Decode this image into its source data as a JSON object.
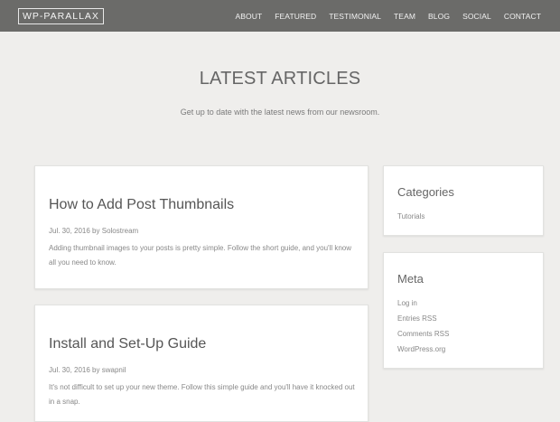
{
  "header": {
    "logo": "WP-PARALLAX",
    "nav": [
      "ABOUT",
      "FEATURED",
      "TESTIMONIAL",
      "TEAM",
      "BLOG",
      "SOCIAL",
      "CONTACT"
    ]
  },
  "section": {
    "title": "LATEST ARTICLES",
    "subtitle": "Get up to date with the latest news from our newsroom."
  },
  "posts": [
    {
      "title": "How to Add Post Thumbnails",
      "date": "Jul. 30, 2016",
      "by": "by",
      "author": "Solostream",
      "excerpt": "Adding thumbnail images to your posts is pretty simple. Follow the short guide, and you'll know all you need to know."
    },
    {
      "title": "Install and Set-Up Guide",
      "date": "Jul. 30, 2016",
      "by": "by",
      "author": "swapnil",
      "excerpt": "It's not difficult to set up your new theme. Follow this simple guide and you'll have it knocked out in a snap."
    }
  ],
  "sidebar": {
    "categories": {
      "title": "Categories",
      "items": [
        "Tutorials"
      ]
    },
    "meta": {
      "title": "Meta",
      "items": [
        "Log in",
        "Entries RSS",
        "Comments RSS",
        "WordPress.org"
      ]
    }
  },
  "colors": {
    "topbar": "#6b6b69",
    "background": "#efeeec",
    "card": "#ffffff"
  }
}
